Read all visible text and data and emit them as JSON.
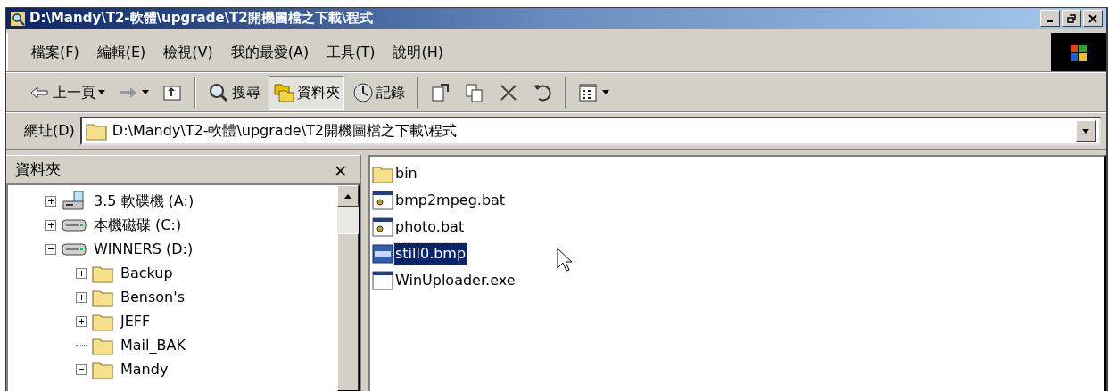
{
  "window": {
    "title": "D:\\Mandy\\T2-軟體\\upgrade\\T2開機圖檔之下載\\程式"
  },
  "menu": [
    "檔案(F)",
    "編輯(E)",
    "檢視(V)",
    "我的最愛(A)",
    "工具(T)",
    "說明(H)"
  ],
  "toolbar": [
    {
      "kind": "back",
      "label": "上一頁",
      "selected": false
    },
    {
      "kind": "forward",
      "selected": false
    },
    {
      "kind": "up",
      "selected": false
    },
    {
      "kind": "search",
      "label": "搜尋",
      "selected": false
    },
    {
      "kind": "folders",
      "label": "資料夾",
      "selected": true
    },
    {
      "kind": "history",
      "label": "記錄",
      "selected": false
    },
    {
      "kind": "move",
      "selected": false
    },
    {
      "kind": "copy",
      "selected": false
    },
    {
      "kind": "delete",
      "selected": false
    },
    {
      "kind": "undo",
      "selected": false
    },
    {
      "kind": "views",
      "selected": false
    }
  ],
  "address": {
    "label": "網址(D)",
    "value": "D:\\Mandy\\T2-軟體\\upgrade\\T2開機圖檔之下載\\程式"
  },
  "folder_pane": {
    "title": "資料夾",
    "close": "×",
    "tree": [
      {
        "kind": "floppy",
        "label": "3.5 軟碟機 (A:)",
        "expanded": false
      },
      {
        "kind": "drive",
        "label": "本機磁碟 (C:)",
        "expanded": false
      },
      {
        "kind": "drive",
        "label": "WINNERS (D:)",
        "expanded": true,
        "children": [
          {
            "kind": "folder",
            "label": "Backup",
            "expanded": false
          },
          {
            "kind": "folder",
            "label": "Benson's",
            "expanded": false
          },
          {
            "kind": "folder",
            "label": "JEFF",
            "expanded": false
          },
          {
            "kind": "folder",
            "label": "Mail_BAK"
          },
          {
            "kind": "folder",
            "label": "Mandy",
            "expanded": true
          }
        ]
      }
    ]
  },
  "files": [
    {
      "kind": "folder",
      "name": "bin",
      "selected": false
    },
    {
      "kind": "batch",
      "name": "bmp2mpeg.bat",
      "selected": false
    },
    {
      "kind": "batch",
      "name": "photo.bat",
      "selected": false
    },
    {
      "kind": "bitmap",
      "name": "still0.bmp",
      "selected": true
    },
    {
      "kind": "app",
      "name": "WinUploader.exe",
      "selected": false
    }
  ]
}
